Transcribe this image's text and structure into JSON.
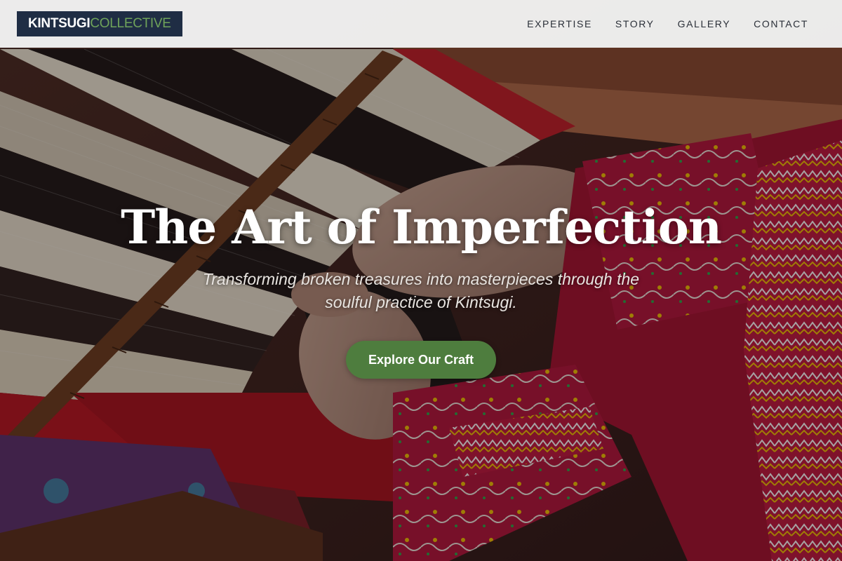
{
  "colors": {
    "header_bg": "#f4f4f4",
    "logo_bg": "#1f2d44",
    "logo_accent": "#6fa35a",
    "nav_text": "#2a2f38",
    "cta_bg": "#4e7d3e",
    "hero_text": "#ffffff"
  },
  "header": {
    "logo": {
      "primary": "KINTSUGI",
      "secondary": "COLLECTIVE"
    },
    "nav": [
      {
        "label": "EXPERTISE"
      },
      {
        "label": "STORY"
      },
      {
        "label": "GALLERY"
      },
      {
        "label": "CONTACT"
      }
    ]
  },
  "hero": {
    "background_image": "hands weaving red, black and white threads on a loom",
    "title": "The Art of Imperfection",
    "subtitle": "Transforming broken treasures into masterpieces through the soulful practice of Kintsugi.",
    "cta_label": "Explore Our Craft"
  }
}
